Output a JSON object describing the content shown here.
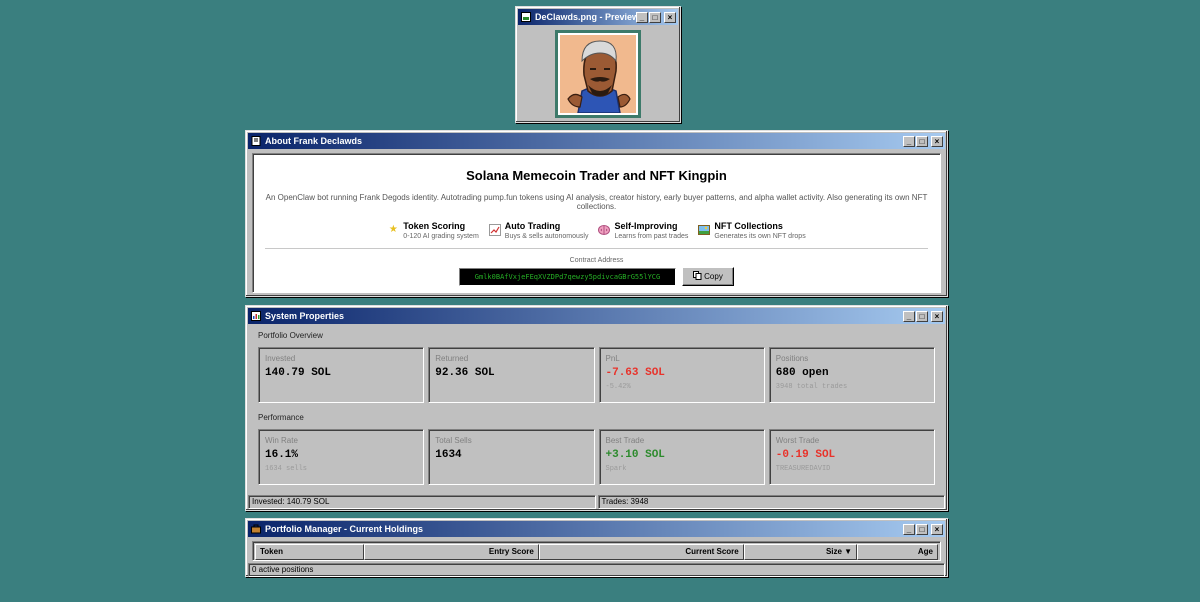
{
  "preview": {
    "title": "DeClawds.png - Preview"
  },
  "about": {
    "title": "About Frank Declawds",
    "heading": "Solana Memecoin Trader and NFT Kingpin",
    "description": "An OpenClaw bot running Frank Degods identity. Autotrading pump.fun tokens using AI analysis, creator history, early buyer patterns, and alpha wallet activity. Also generating its own NFT collections.",
    "features": [
      {
        "icon": "star-icon",
        "title": "Token Scoring",
        "subtitle": "0-120 AI grading system"
      },
      {
        "icon": "chart-icon",
        "title": "Auto Trading",
        "subtitle": "Buys & sells autonomously"
      },
      {
        "icon": "brain-icon",
        "title": "Self-Improving",
        "subtitle": "Learns from past trades"
      },
      {
        "icon": "picture-icon",
        "title": "NFT Collections",
        "subtitle": "Generates its own NFT drops"
      }
    ],
    "contract_label": "Contract Address",
    "contract_address": "Gmlk0BAfVxjeFEqXVZDPd7qewzy5pdivcaGBrG55lYCG",
    "copy_label": "Copy"
  },
  "system": {
    "title": "System Properties",
    "portfolio_label": "Portfolio Overview",
    "portfolio": [
      {
        "label": "Invested",
        "value": "140.79 SOL",
        "sub": ""
      },
      {
        "label": "Returned",
        "value": "92.36 SOL",
        "sub": ""
      },
      {
        "label": "PnL",
        "value": "-7.63 SOL",
        "sub": "-5.42%"
      },
      {
        "label": "Positions",
        "value": "680 open",
        "sub": "3948 total trades"
      }
    ],
    "performance_label": "Performance",
    "performance": [
      {
        "label": "Win Rate",
        "value": "16.1%",
        "sub": "1634 sells"
      },
      {
        "label": "Total Sells",
        "value": "1634",
        "sub": ""
      },
      {
        "label": "Best Trade",
        "value": "+3.10 SOL",
        "sub": "Spark"
      },
      {
        "label": "Worst Trade",
        "value": "-0.19 SOL",
        "sub": "TREASUREDAVID"
      }
    ],
    "status_invested": "Invested: 140.79 SOL",
    "status_trades": "Trades: 3948"
  },
  "portfolio_manager": {
    "title": "Portfolio Manager - Current Holdings",
    "columns": [
      "Token",
      "Entry Score",
      "Current Score",
      "Size ▼",
      "Age"
    ],
    "status": "0 active positions"
  },
  "colors": {
    "desktop": "#3a7f7f",
    "title_start": "#0a246a",
    "negative": "#e8322a",
    "positive": "#2c8a2c",
    "contract_text": "#26b026"
  }
}
